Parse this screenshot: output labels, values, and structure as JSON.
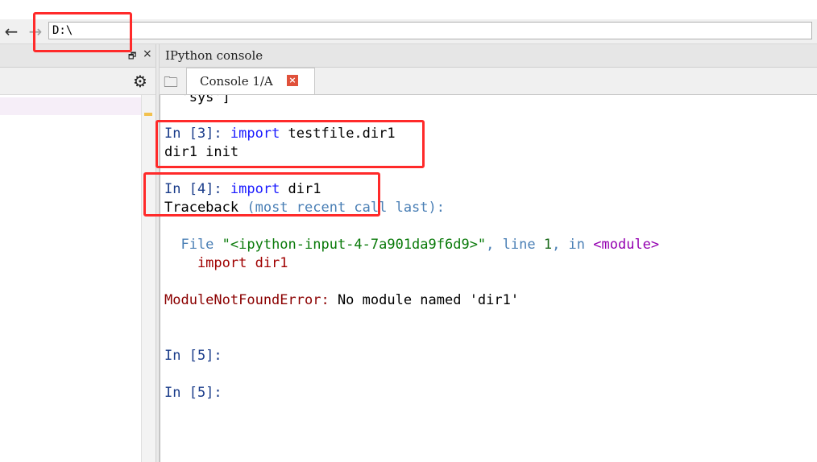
{
  "pathbar": {
    "back_icon": "←",
    "forward_icon": "→",
    "path_value": "D:\\"
  },
  "left_pane": {
    "undock_icon": "🗗",
    "close_icon": "×",
    "gear_icon": "⚙"
  },
  "right_pane": {
    "title": "IPython console",
    "folder_icon": "🗀",
    "tab_label": "Console 1/A",
    "tab_close_icon": "×"
  },
  "console": {
    "lines": [
      "  'sys']",
      "In [3]: import testfile.dir1",
      "dir1 init",
      "In [4]: import dir1",
      "Traceback (most recent call last):",
      "  File \"<ipython-input-4-7a901da9f6d9>\", line 1, in <module>",
      "    import dir1",
      "ModuleNotFoundError: No module named 'dir1'",
      "In [5]:",
      "In [5]:"
    ],
    "parts": {
      "l0": "  'sys']",
      "p3": "In [3]: ",
      "kw_import": "import",
      "mod_testfile": " testfile.dir1",
      "out_dir1_init": "dir1 init",
      "p4": "In [4]: ",
      "mod_dir1": " dir1",
      "traceback": "Traceback ",
      "traceback_rest": "(most recent call last):",
      "file_label": "  File ",
      "file_str": "\"<ipython-input-4-7a901da9f6d9>\"",
      "comma_line": ", line ",
      "line_num": "1",
      "comma_in": ", in ",
      "module_tag": "<module>",
      "import_src": "    import dir1",
      "err_name": "ModuleNotFoundError:",
      "err_msg": " No module named 'dir1'",
      "p5a": "In [5]:",
      "p5b": "In [5]:"
    }
  },
  "colors": {
    "annotation_red": "#ff2a2a",
    "prompt_blue": "#1a3c8a",
    "error_red": "#8b0000",
    "tab_close_red": "#e0513b"
  }
}
